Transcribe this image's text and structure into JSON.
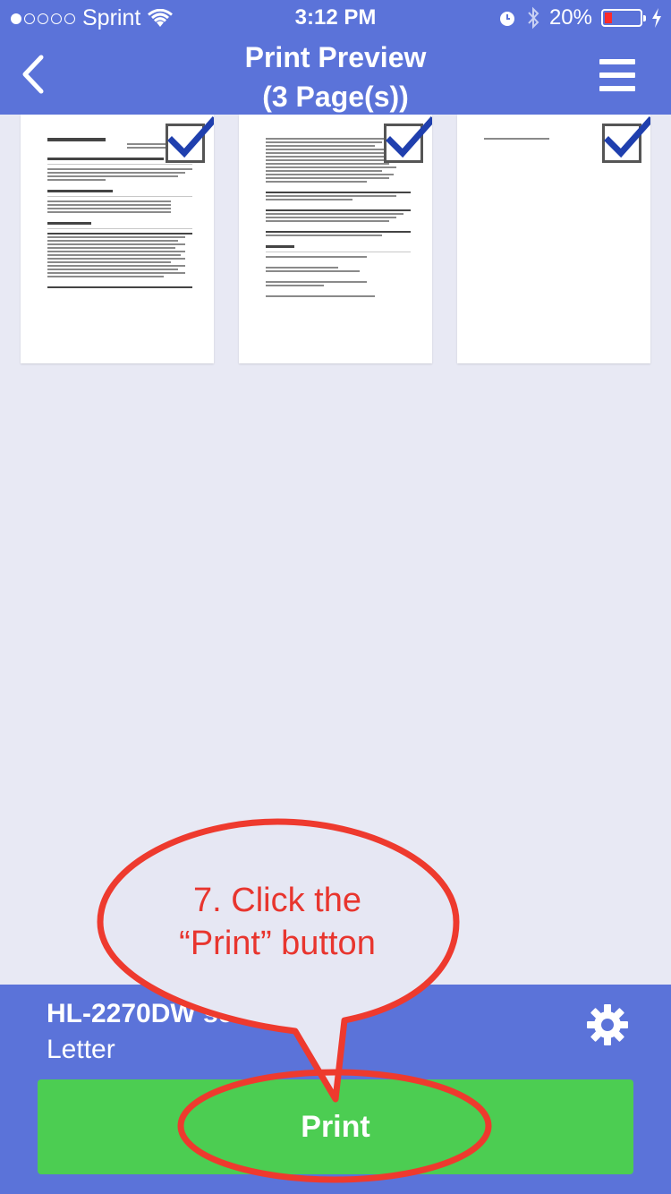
{
  "status_bar": {
    "carrier": "Sprint",
    "time": "3:12 PM",
    "battery": "20%",
    "battery_level": 0.2
  },
  "nav": {
    "title_line1": "Print Preview",
    "title_line2": "(3 Page(s))",
    "back_icon": "chevron-left-icon",
    "menu_icon": "hamburger-icon"
  },
  "pages": [
    {
      "checked": true
    },
    {
      "checked": true
    },
    {
      "checked": true
    }
  ],
  "printer": {
    "name": "HL-2270DW se",
    "paper": "Letter",
    "settings_icon": "gear-icon"
  },
  "print_button": "Print",
  "annotation": {
    "line1": "7. Click the",
    "line2": "“Print” button",
    "color": "#e8352e"
  },
  "colors": {
    "header": "#5b73d9",
    "print_button": "#4ccd52",
    "background": "#e8e9f4"
  }
}
